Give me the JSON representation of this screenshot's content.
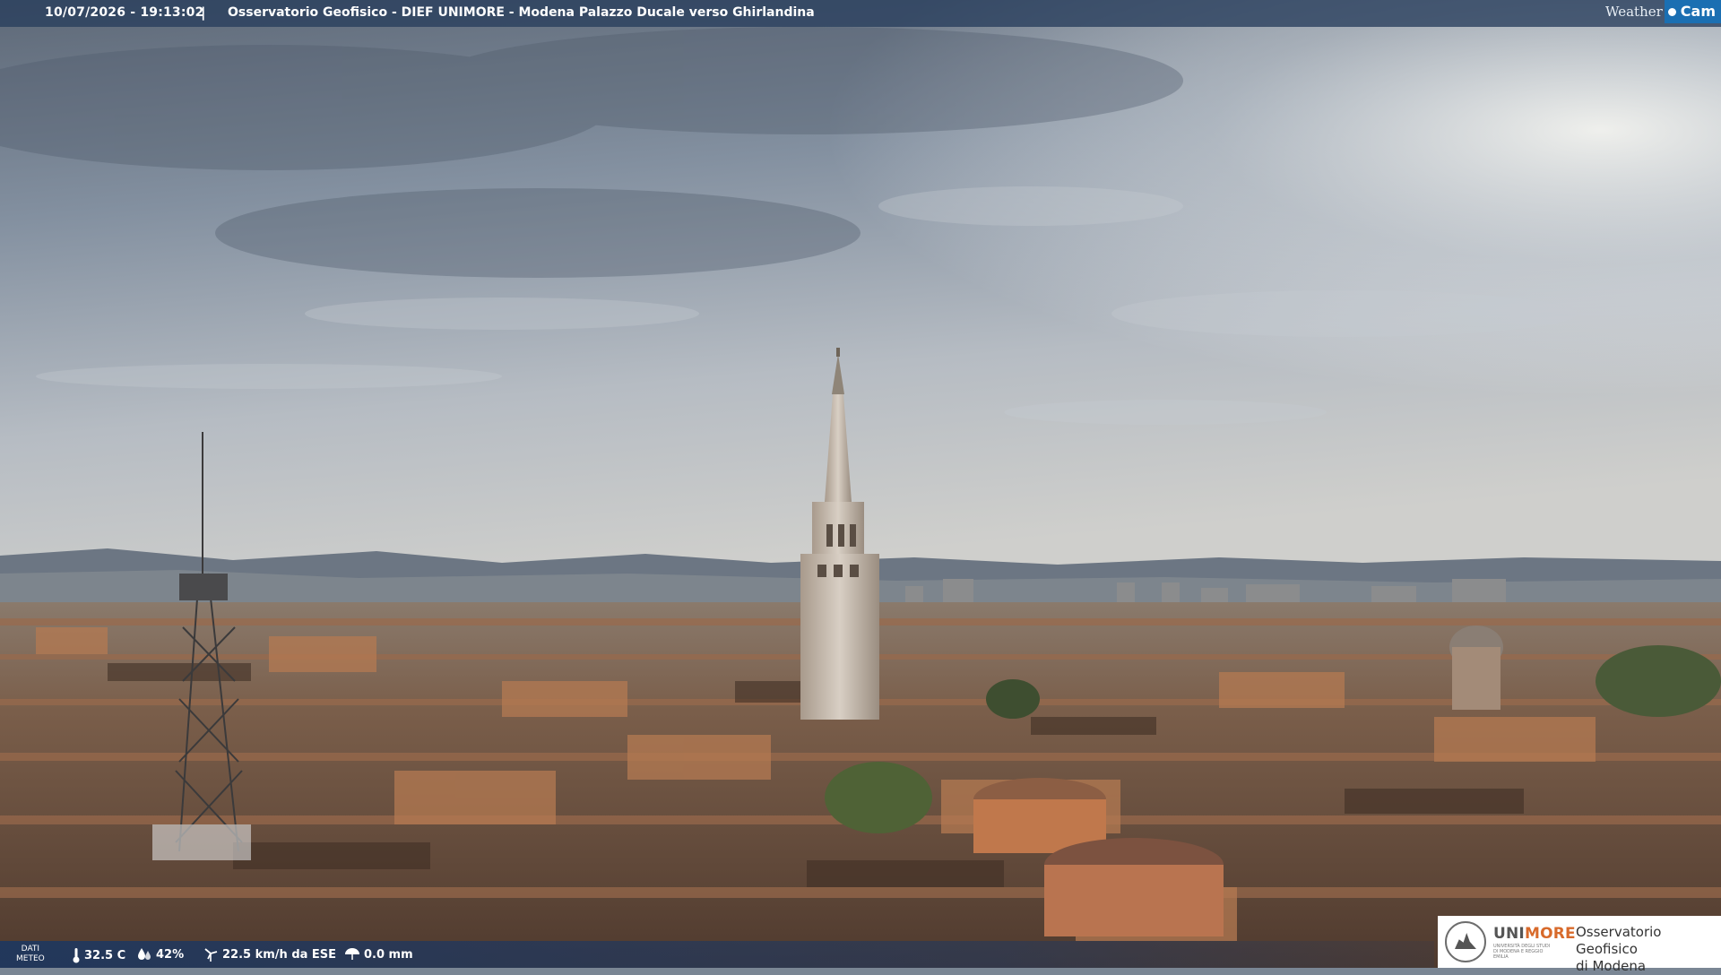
{
  "header": {
    "timestamp": "10/07/2026 - 19:13:02",
    "separator": "|",
    "location": "Osservatorio Geofisico - DIEF UNIMORE - Modena Palazzo Ducale verso Ghirlandina"
  },
  "weathercam_logo": {
    "weather": "Weather",
    "cam": "Cam"
  },
  "meteo": {
    "label_line1": "DATI",
    "label_line2": "METEO",
    "temperature": "32.5 C",
    "humidity": "42%",
    "wind": "22.5 km/h da ESE",
    "rain": "0.0 mm"
  },
  "badge": {
    "brand_prefix": "UNI",
    "brand_suffix": "MORE",
    "subline": "UNIVERSITÀ DEGLI STUDI DI MODENA E REGGIO EMILIA",
    "observatory_line1": "Osservatorio Geofisico",
    "observatory_line2": "di Modena"
  },
  "colors": {
    "banner": "#283e5c",
    "accent_orange": "#d86a2b",
    "weathercam_blue": "#1b6fb2"
  }
}
